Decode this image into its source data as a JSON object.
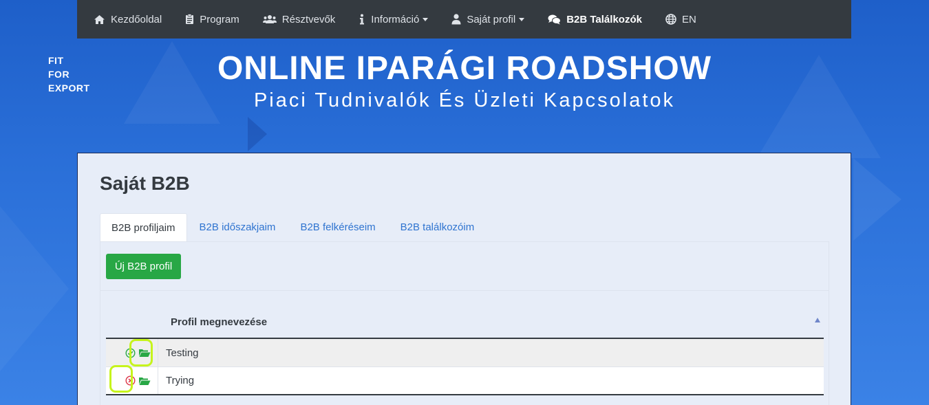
{
  "nav": {
    "items": [
      {
        "label": "Kezdőoldal",
        "icon": "home-icon"
      },
      {
        "label": "Program",
        "icon": "clipboard-icon"
      },
      {
        "label": "Résztvevők",
        "icon": "users-icon"
      },
      {
        "label": "Információ",
        "icon": "info-icon",
        "dropdown": true
      },
      {
        "label": "Saját profil",
        "icon": "user-icon",
        "dropdown": true
      },
      {
        "label": "B2B Találkozók",
        "icon": "chat-icon",
        "active": true
      },
      {
        "label": "EN",
        "icon": "globe-icon"
      }
    ]
  },
  "header": {
    "logo_lines": [
      "FIT",
      "FOR",
      "EXPORT"
    ],
    "title": "ONLINE IPARÁGI ROADSHOW",
    "subtitle": "Piaci Tudnivalók És Üzleti Kapcsolatok"
  },
  "page": {
    "title": "Saját B2B",
    "tabs": [
      {
        "label": "B2B profiljaim",
        "active": true
      },
      {
        "label": "B2B időszakjaim"
      },
      {
        "label": "B2B felkéréseim"
      },
      {
        "label": "B2B találkozóim"
      }
    ],
    "new_button": "Új B2B profil",
    "table": {
      "column_header": "Profil megnevezése",
      "rows": [
        {
          "name": "Testing",
          "status": "active"
        },
        {
          "name": "Trying",
          "status": "inactive"
        }
      ]
    }
  },
  "colors": {
    "navbar": "#343a40",
    "accent_green": "#28a745",
    "link_blue": "#2f74d0",
    "status_ok": "#28a745",
    "status_err": "#dc3545",
    "highlight": "#c6f41c"
  }
}
